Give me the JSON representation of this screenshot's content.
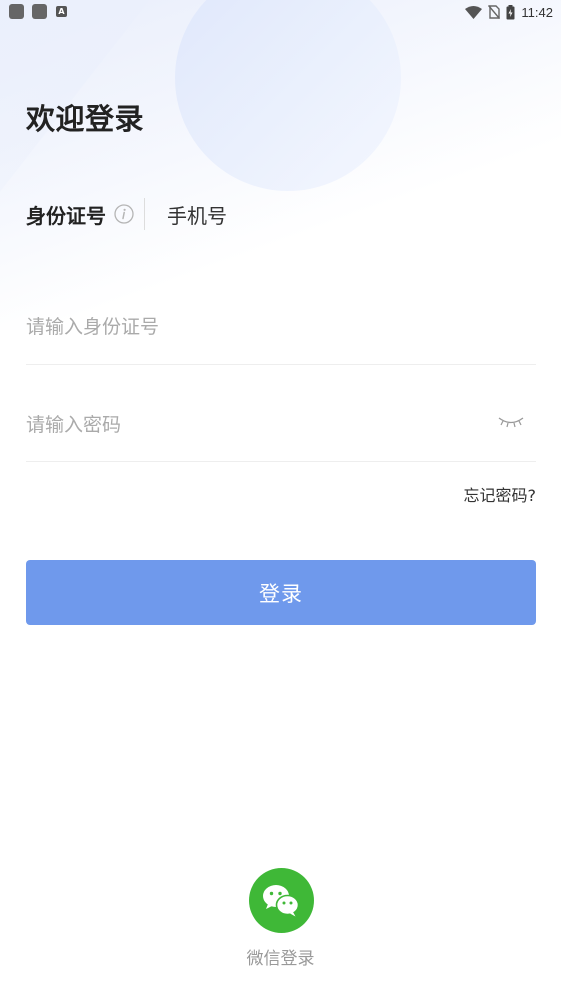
{
  "status_bar": {
    "time": "11:42",
    "indicator_letter": "A",
    "icons": [
      "app-notification-icon",
      "app-notification-icon",
      "keyboard-a-icon",
      "wifi-icon",
      "no-sim-icon",
      "battery-charging-icon"
    ]
  },
  "page": {
    "title": "欢迎登录"
  },
  "tabs": [
    {
      "label": "身份证号",
      "active": true
    },
    {
      "label": "手机号",
      "active": false
    }
  ],
  "form": {
    "id_placeholder": "请输入身份证号",
    "id_value": "",
    "password_placeholder": "请输入密码",
    "password_value": "",
    "forgot_label": "忘记密码?",
    "login_label": "登录"
  },
  "third_party": {
    "wechat_label": "微信登录"
  },
  "colors": {
    "primary": "#6f99ec",
    "wechat": "#3fb837",
    "placeholder": "#aaaaaa"
  }
}
